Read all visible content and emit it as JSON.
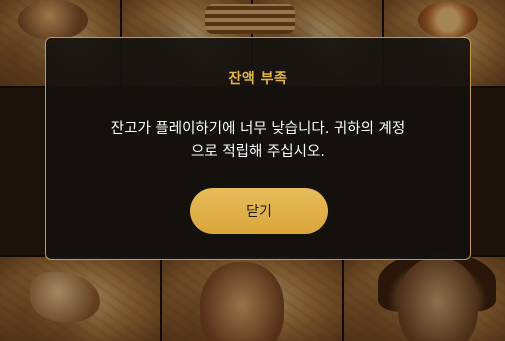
{
  "dialog": {
    "title": "잔액 부족",
    "message_line1": "잔고가 플레이하기에 너무 낮습니다. 귀하의 계정",
    "message_line2": "으로 적립해 주십시오.",
    "close_label": "닫기"
  },
  "colors": {
    "accent": "#e6b546",
    "dialog_bg": "#14110e",
    "button_bg": "#e0b04b"
  }
}
